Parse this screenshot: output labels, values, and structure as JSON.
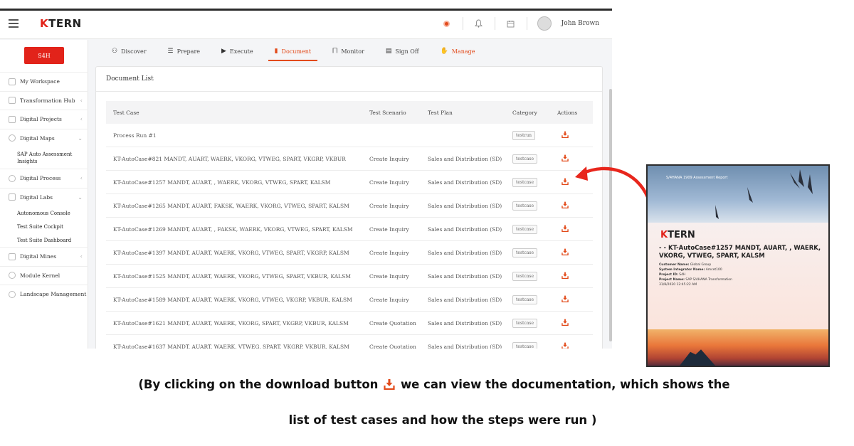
{
  "app": {
    "logo_text": "TERN",
    "logo_mark": "K",
    "user_name": "John Brown",
    "accent_color": "#e24a1a"
  },
  "sidebar": {
    "system_button": "S4H",
    "items": [
      {
        "label": "My Workspace",
        "icon": "workspace-icon"
      },
      {
        "label": "Transformation Hub",
        "icon": "grid-icon"
      },
      {
        "label": "Digital Projects",
        "icon": "send-icon"
      },
      {
        "label": "Digital Maps",
        "icon": "map-icon"
      },
      {
        "label": "SAP Auto Assessment Insights",
        "sub": true
      },
      {
        "label": "Digital Process",
        "icon": "process-icon"
      },
      {
        "label": "Digital Labs",
        "icon": "list-icon"
      },
      {
        "label": "Autonomous Console",
        "sub": true
      },
      {
        "label": "Test Suite Cockpit",
        "sub": true
      },
      {
        "label": "Test Suite Dashboard",
        "sub": true
      },
      {
        "label": "Digital Mines",
        "icon": "mines-icon"
      },
      {
        "label": "Module Kernel",
        "icon": "kernel-icon"
      },
      {
        "label": "Landscape Management",
        "icon": "gear-icon"
      }
    ]
  },
  "tabs": [
    {
      "label": "Discover",
      "icon": "binoculars-icon"
    },
    {
      "label": "Prepare",
      "icon": "list-icon"
    },
    {
      "label": "Execute",
      "icon": "play-icon"
    },
    {
      "label": "Document",
      "icon": "document-icon",
      "active": true
    },
    {
      "label": "Monitor",
      "icon": "chart-icon"
    },
    {
      "label": "Sign Off",
      "icon": "signoff-icon"
    },
    {
      "label": "Manage",
      "icon": "thumbs-up-icon"
    }
  ],
  "document_list": {
    "title": "Document List",
    "columns": [
      "Test Case",
      "Test Scenario",
      "Test Plan",
      "Category",
      "Actions"
    ],
    "rows": [
      {
        "test_case": "Process Run #1",
        "scenario": "",
        "plan": "",
        "category": "testrun"
      },
      {
        "test_case": "KT-AutoCase#821 MANDT, AUART, WAERK, VKORG, VTWEG, SPART, VKGRP, VKBUR",
        "scenario": "Create Inquiry",
        "plan": "Sales and Distribution (SD)",
        "category": "testcase"
      },
      {
        "test_case": "KT-AutoCase#1257 MANDT, AUART, , WAERK, VKORG, VTWEG, SPART, KALSM",
        "scenario": "Create Inquiry",
        "plan": "Sales and Distribution (SD)",
        "category": "testcase"
      },
      {
        "test_case": "KT-AutoCase#1265 MANDT, AUART, FAKSK, WAERK, VKORG, VTWEG, SPART, KALSM",
        "scenario": "Create Inquiry",
        "plan": "Sales and Distribution (SD)",
        "category": "testcase"
      },
      {
        "test_case": "KT-AutoCase#1269 MANDT, AUART, , FAKSK, WAERK, VKORG, VTWEG, SPART, KALSM",
        "scenario": "Create Inquiry",
        "plan": "Sales and Distribution (SD)",
        "category": "testcase"
      },
      {
        "test_case": "KT-AutoCase#1397 MANDT, AUART, WAERK, VKORG, VTWEG, SPART, VKGRP, KALSM",
        "scenario": "Create Inquiry",
        "plan": "Sales and Distribution (SD)",
        "category": "testcase"
      },
      {
        "test_case": "KT-AutoCase#1525 MANDT, AUART, WAERK, VKORG, VTWEG, SPART, VKBUR, KALSM",
        "scenario": "Create Inquiry",
        "plan": "Sales and Distribution (SD)",
        "category": "testcase"
      },
      {
        "test_case": "KT-AutoCase#1589 MANDT, AUART, WAERK, VKORG, VTWEG, VKGRP, VKBUR, KALSM",
        "scenario": "Create Inquiry",
        "plan": "Sales and Distribution (SD)",
        "category": "testcase"
      },
      {
        "test_case": "KT-AutoCase#1621 MANDT, AUART, WAERK, VKORG, SPART, VKGRP, VKBUR, KALSM",
        "scenario": "Create Quotation",
        "plan": "Sales and Distribution (SD)",
        "category": "testcase"
      },
      {
        "test_case": "KT-AutoCase#1637 MANDT, AUART, WAERK, VTWEG, SPART, VKGRP, VKBUR, KALSM",
        "scenario": "Create Quotation",
        "plan": "Sales and Distribution (SD)",
        "category": "testcase"
      }
    ]
  },
  "report": {
    "header": "S/4HANA 1909 Assessment Report",
    "logo_text": "TERN",
    "logo_mark": "K",
    "title": "- - KT-AutoCase#1257 MANDT, AUART, , WAERK, VKORG, VTWEG, SPART, KALSM",
    "customer_label": "Customer Name:",
    "customer": "Global Group",
    "integrator_label": "System Integrator Name:",
    "integrator": "Amcet100",
    "project_id_label": "Project ID:",
    "project_id": "S4H",
    "project_name_label": "Project Name:",
    "project_name": "SAP S/4HANA Transformation",
    "date": "31/8/2020 12:45:22 AM"
  },
  "caption": {
    "line1_before": "(By clicking on the download button",
    "line1_after": "we can view the documentation, which shows the",
    "line2": "list of test cases and how the steps were run )"
  }
}
